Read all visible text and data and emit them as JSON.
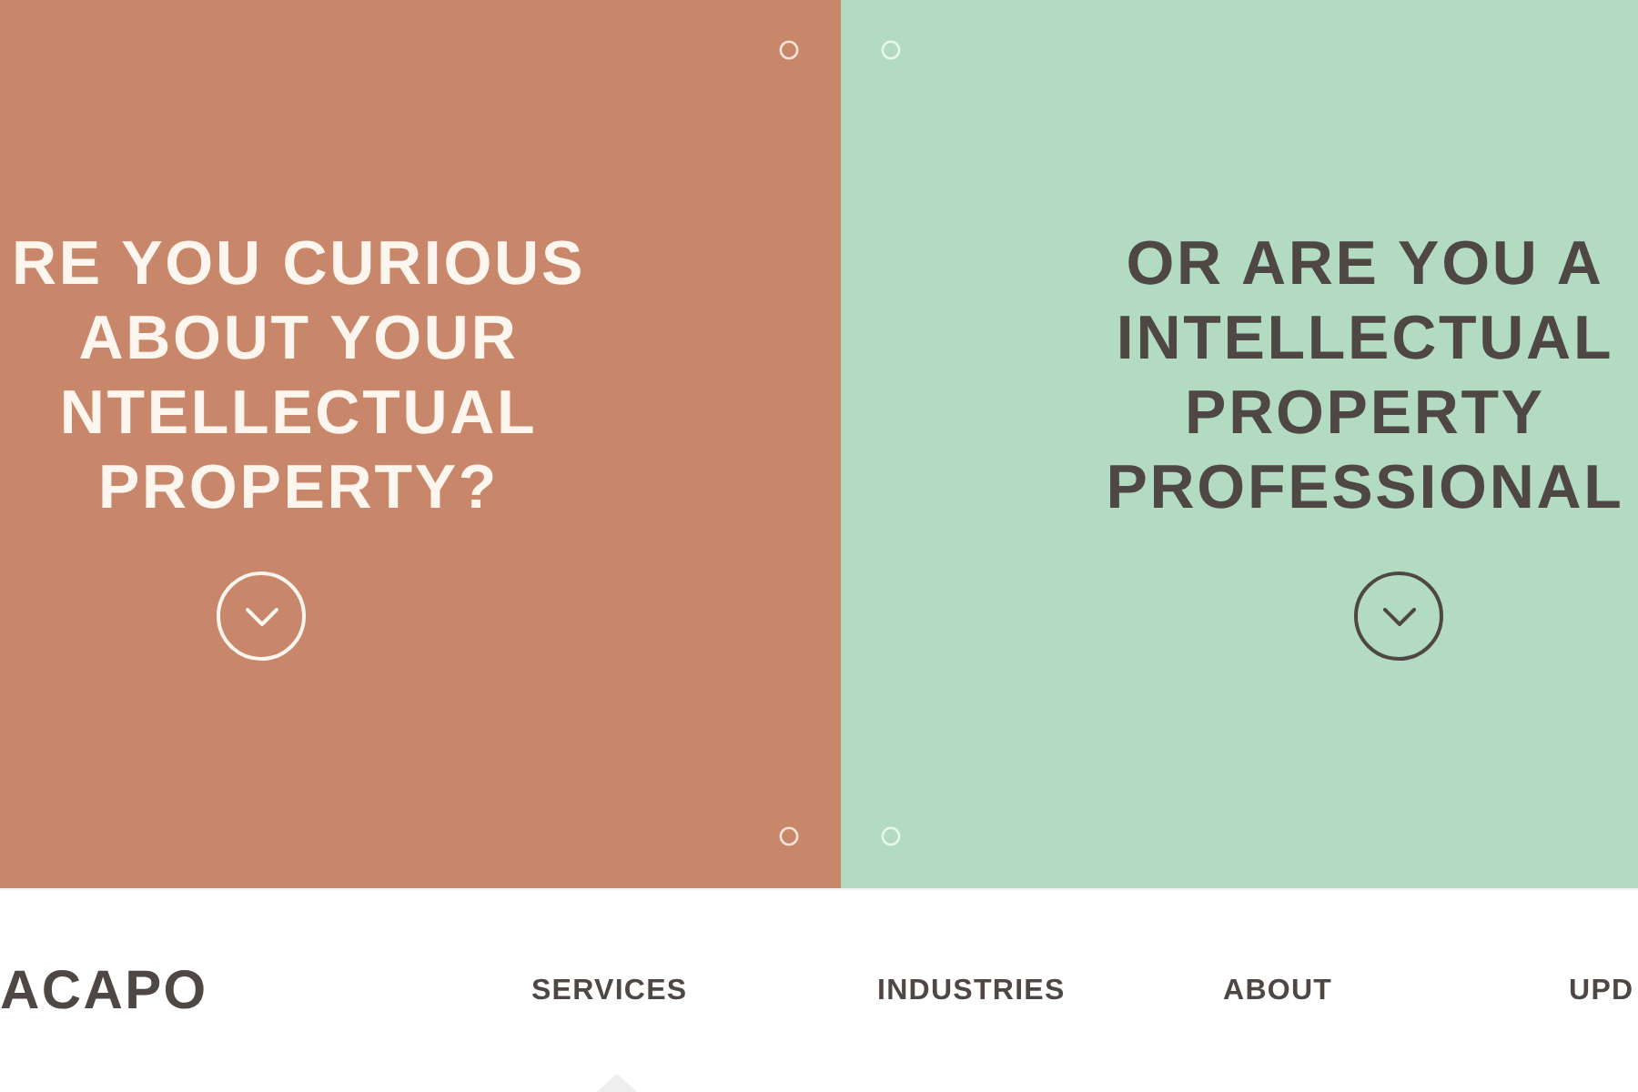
{
  "panels": [
    {
      "kind": "light",
      "color": "#c8876a",
      "heading_lines": [
        "RE YOU CURIOUS",
        "ABOUT YOUR",
        "NTELLECTUAL",
        "PROPERTY?"
      ]
    },
    {
      "kind": "dark",
      "color": "#b3dbc2",
      "heading_lines": [
        "OR ARE YOU A",
        "INTELLECTUAL",
        "PROPERTY",
        "PROFESSIONAL"
      ]
    }
  ],
  "nav": {
    "logo": "ACAPO",
    "items": [
      "SERVICES",
      "INDUSTRIES",
      "ABOUT",
      "UPD"
    ]
  }
}
